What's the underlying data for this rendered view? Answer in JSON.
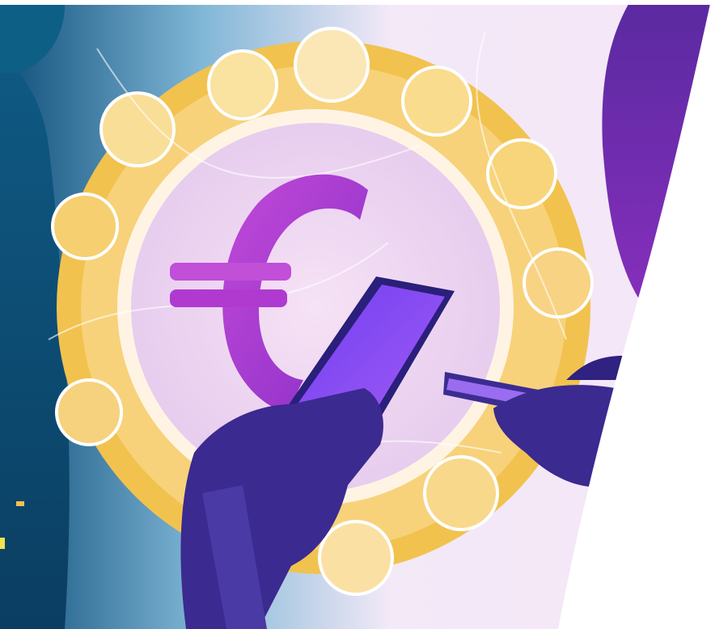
{
  "illustration": {
    "subject": "euro-mobile-payment",
    "glyph": "€",
    "colors": {
      "background_left": "#0f4f7a",
      "background_right": "#f4e6f7",
      "coin_ring": "#f2c24f",
      "coin_light": "#fae2a0",
      "euro_symbol": "#b03ad0",
      "phone": "#7a3cf0",
      "hand": "#3b2a8f",
      "woman_silhouette": "#6a1fa5",
      "cutout": "#ffffff"
    }
  }
}
